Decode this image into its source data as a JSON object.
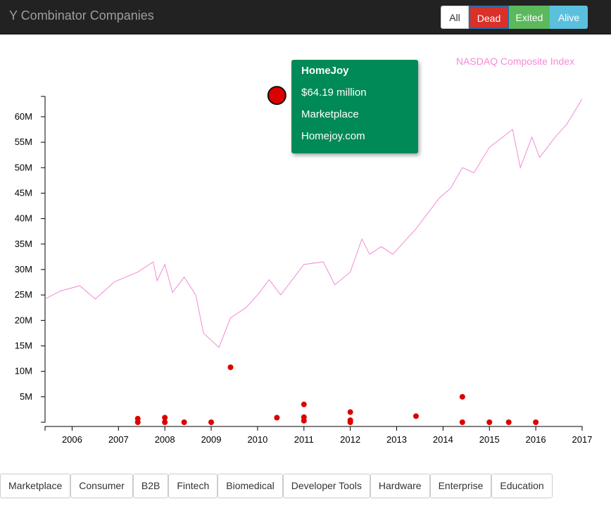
{
  "header": {
    "title": "Y Combinator Companies",
    "filters": [
      "All",
      "Dead",
      "Exited",
      "Alive"
    ]
  },
  "colors": {
    "dead": "#dd0000",
    "nasdaq": "#f48ad6",
    "tooltip": "#008a57",
    "exited": "#5cb85c",
    "alive": "#5bc0de"
  },
  "tooltip": {
    "name": "HomeJoy",
    "amount": "$64.19 million",
    "category": "Marketplace",
    "website": "Homejoy.com"
  },
  "categories": [
    "Marketplace",
    "Consumer",
    "B2B",
    "Fintech",
    "Biomedical",
    "Developer Tools",
    "Hardware",
    "Enterprise",
    "Education"
  ],
  "chart_data": {
    "type": "scatter",
    "title": "",
    "xlabel": "",
    "ylabel": "",
    "xlim": [
      "2005-06",
      "2017-01"
    ],
    "ylim": [
      0,
      64000000
    ],
    "x_ticks": [
      "2006",
      "2007",
      "2008",
      "2009",
      "2010",
      "2011",
      "2012",
      "2013",
      "2014",
      "2015",
      "2016",
      "2017"
    ],
    "y_ticks": [
      "5M",
      "10M",
      "15M",
      "20M",
      "25M",
      "30M",
      "35M",
      "40M",
      "45M",
      "50M",
      "55M",
      "60M"
    ],
    "series": [
      {
        "type": "scatter",
        "points": [
          {
            "x": "2007-06",
            "y": 700000
          },
          {
            "x": "2007-06",
            "y": 0
          },
          {
            "x": "2008-01",
            "y": 900000
          },
          {
            "x": "2008-01",
            "y": 0
          },
          {
            "x": "2008-06",
            "y": 0
          },
          {
            "x": "2009-01",
            "y": 0
          },
          {
            "x": "2009-06",
            "y": 10800000
          },
          {
            "x": "2010-06",
            "y": 900000
          },
          {
            "x": "2011-01",
            "y": 3500000
          },
          {
            "x": "2011-01",
            "y": 1000000
          },
          {
            "x": "2011-01",
            "y": 300000
          },
          {
            "x": "2012-01",
            "y": 2000000
          },
          {
            "x": "2012-01",
            "y": 400000
          },
          {
            "x": "2012-01",
            "y": 0
          },
          {
            "x": "2013-06",
            "y": 1200000
          },
          {
            "x": "2014-06",
            "y": 5000000
          },
          {
            "x": "2014-06",
            "y": 0
          },
          {
            "x": "2015-01",
            "y": 0
          },
          {
            "x": "2015-06",
            "y": 0
          },
          {
            "x": "2016-01",
            "y": 0
          },
          {
            "x": "2010-06",
            "y": 64190000
          }
        ]
      },
      {
        "name": "NASDAQ Composite Index",
        "type": "line",
        "points": [
          {
            "x": "2005-06",
            "y": 24200000
          },
          {
            "x": "2005-10",
            "y": 25800000
          },
          {
            "x": "2006-03",
            "y": 26800000
          },
          {
            "x": "2006-07",
            "y": 24200000
          },
          {
            "x": "2006-12",
            "y": 27600000
          },
          {
            "x": "2007-06",
            "y": 29500000
          },
          {
            "x": "2007-10",
            "y": 31500000
          },
          {
            "x": "2007-11",
            "y": 27800000
          },
          {
            "x": "2008-01",
            "y": 31000000
          },
          {
            "x": "2008-03",
            "y": 25500000
          },
          {
            "x": "2008-06",
            "y": 28500000
          },
          {
            "x": "2008-09",
            "y": 25000000
          },
          {
            "x": "2008-11",
            "y": 17500000
          },
          {
            "x": "2009-03",
            "y": 14700000
          },
          {
            "x": "2009-06",
            "y": 20500000
          },
          {
            "x": "2009-10",
            "y": 22500000
          },
          {
            "x": "2010-01",
            "y": 25000000
          },
          {
            "x": "2010-04",
            "y": 28000000
          },
          {
            "x": "2010-07",
            "y": 25000000
          },
          {
            "x": "2011-01",
            "y": 31000000
          },
          {
            "x": "2011-06",
            "y": 31500000
          },
          {
            "x": "2011-09",
            "y": 27000000
          },
          {
            "x": "2012-01",
            "y": 29500000
          },
          {
            "x": "2012-04",
            "y": 36000000
          },
          {
            "x": "2012-06",
            "y": 33000000
          },
          {
            "x": "2012-09",
            "y": 34500000
          },
          {
            "x": "2012-12",
            "y": 33000000
          },
          {
            "x": "2013-06",
            "y": 38000000
          },
          {
            "x": "2013-12",
            "y": 44000000
          },
          {
            "x": "2014-03",
            "y": 46000000
          },
          {
            "x": "2014-06",
            "y": 50000000
          },
          {
            "x": "2014-09",
            "y": 49000000
          },
          {
            "x": "2015-01",
            "y": 54000000
          },
          {
            "x": "2015-07",
            "y": 57500000
          },
          {
            "x": "2015-09",
            "y": 50000000
          },
          {
            "x": "2015-12",
            "y": 56000000
          },
          {
            "x": "2016-02",
            "y": 52000000
          },
          {
            "x": "2016-06",
            "y": 56000000
          },
          {
            "x": "2016-09",
            "y": 58500000
          },
          {
            "x": "2017-01",
            "y": 63500000
          }
        ]
      }
    ],
    "grid": false,
    "legend": "top-right"
  }
}
